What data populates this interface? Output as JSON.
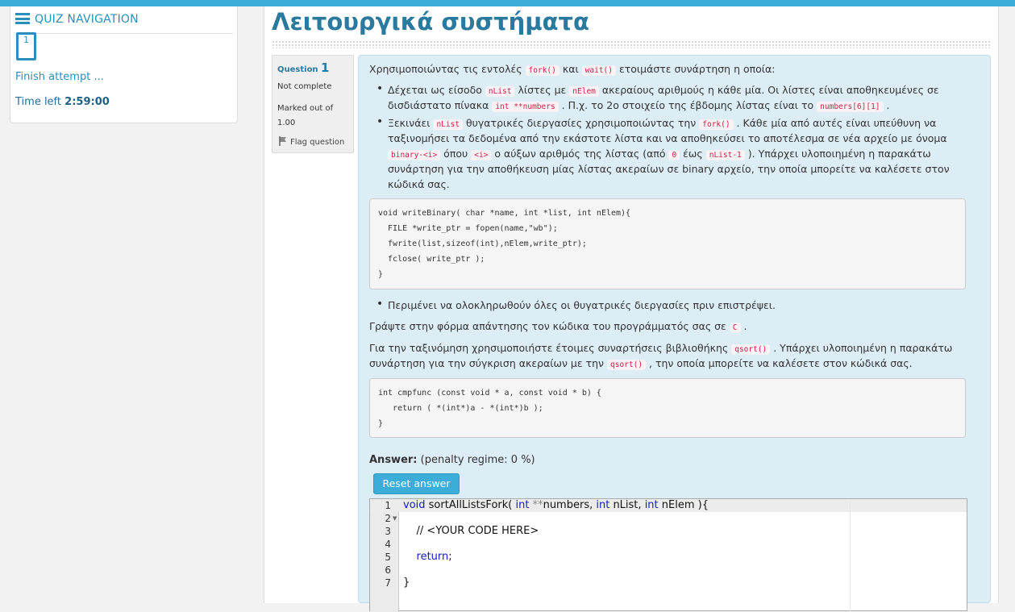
{
  "nav": {
    "title": "QUIZ NAVIGATION",
    "question_button": "1",
    "finish_link": "Finish attempt ...",
    "time_left_label": "Time left",
    "time_left_value": "2:59:00"
  },
  "page": {
    "title": "Λειτουργικά συστήματα"
  },
  "question_info": {
    "label": "Question",
    "number": "1",
    "state": "Not complete",
    "marked": "Marked out of 1.00",
    "flag": "Flag question"
  },
  "question": {
    "intro": [
      "Χρησιμοποιώντας τις εντολές ",
      "fork()",
      " και ",
      "wait()",
      " ετοιμάστε συνάρτηση η οποία:"
    ],
    "b1_l1": [
      "Δέχεται ως είσοδο ",
      "nList",
      " λίστες με ",
      "nElem",
      " ακεραίους αριθμούς η κάθε μία. Οι λίστες είναι αποθηκευμένες σε"
    ],
    "b1_l2": [
      "δισδιάστατο πίνακα ",
      "int **numbers",
      " . Π.χ. το 2ο στοιχείο της έβδομης λίστας είναι το ",
      "numbers[6][1]",
      " ."
    ],
    "b2_l1": [
      "Ξεκινάει ",
      "nList",
      " θυγατρικές διεργασίες χρησιμοποιώντας την ",
      "fork()",
      " . Κάθε μία από αυτές είναι υπεύθυνη να"
    ],
    "b2_l2": "ταξινομήσει τα δεδομένα από την εκάστοτε λίστα και να αποθηκεύσει το αποτέλεσμα σε νέα αρχείο με όνομα",
    "b2_l3": [
      "binary-<i>",
      " όπου ",
      "<i>",
      " ο αύξων αριθμός της λίστας (από ",
      "0",
      " έως ",
      "nList-1",
      " ). Υπάρχει υλοποιημένη η παρακάτω"
    ],
    "b2_l4": "συνάρτηση για την αποθήκευση μίας λίστας ακεραίων σε binary αρχείο, την οποία μπορείτε να καλέσετε στον",
    "b2_l5": "κώδικά σας.",
    "code1": "void writeBinary( char *name, int *list, int nElem){\n  FILE *write_ptr = fopen(name,\"wb\");\n  fwrite(list,sizeof(int),nElem,write_ptr);\n  fclose( write_ptr );\n}",
    "b3": "Περιμένει να ολοκληρωθούν όλες οι θυγατρικές διεργασίες πριν επιστρέψει.",
    "p1": [
      "Γράψτε στην φόρμα απάντησης τον κώδικα του προγράμματός σας σε ",
      "C",
      " ."
    ],
    "p2_l1": [
      "Για την ταξινόμηση χρησιμοποιήστε έτοιμες συναρτήσεις βιβλιοθήκης ",
      "qsort()",
      " . Υπάρχει υλοποιημένη η παρακάτω"
    ],
    "p2_l2": [
      "συνάρτηση για την σύγκριση ακεραίων με την ",
      "qsort()",
      " , την οποία μπορείτε να καλέσετε στον κώδικά σας."
    ],
    "code2": "int cmpfunc (const void * a, const void * b) {\n   return ( *(int*)a - *(int*)b );\n}"
  },
  "answer": {
    "label": "Answer:",
    "penalty": "(penalty regime: 0 %)",
    "reset_button": "Reset answer",
    "line_numbers": [
      "1",
      "2",
      "3",
      "4",
      "5",
      "6",
      "7"
    ],
    "code_lines": [
      "void sortAllListsFork( int **numbers, int nList, int nElem ){",
      "",
      "    // <YOUR CODE HERE>",
      "",
      "    return;",
      "",
      "}"
    ]
  }
}
